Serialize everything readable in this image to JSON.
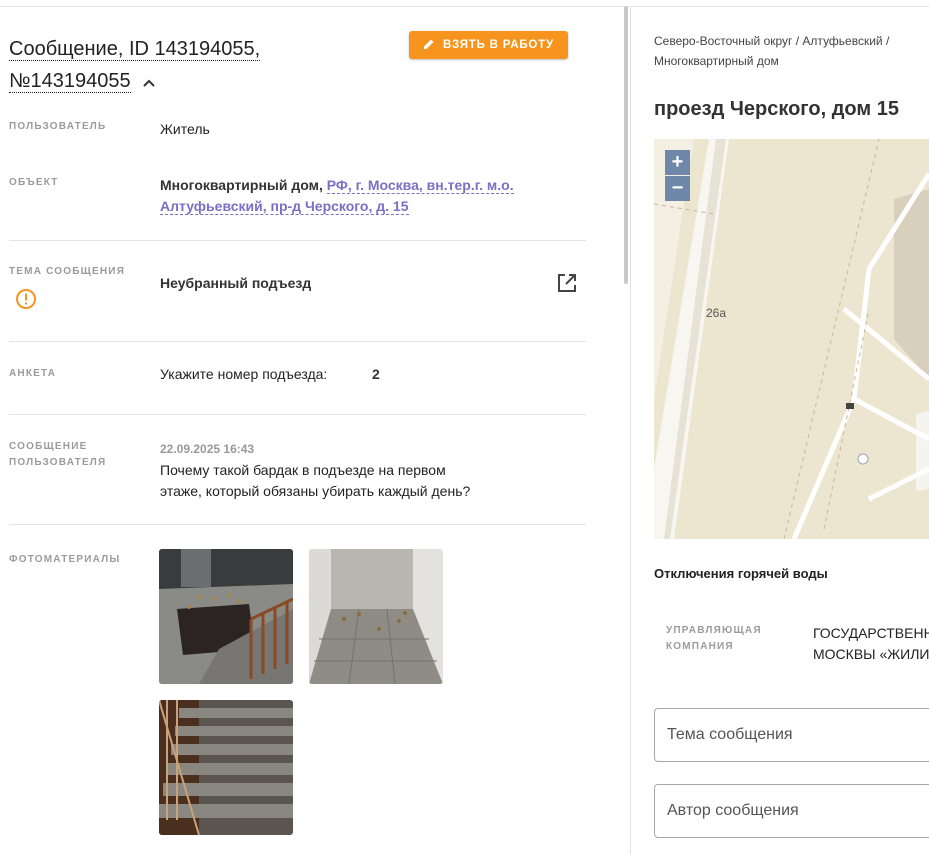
{
  "message": {
    "title_line1": "Сообщение, ID 143194055,",
    "title_line2": "№143194055",
    "take_button": "ВЗЯТЬ В РАБОТУ"
  },
  "fields": {
    "user_label": "ПОЛЬЗОВАТЕЛЬ",
    "user_value": "Житель",
    "object_label": "ОБЪЕКТ",
    "object_type": "Многоквартирный дом,",
    "object_address_line1": "РФ, г. Москва, вн.тер.г. м.о.",
    "object_address_line2": "Алтуфьевский, пр-д Черского, д. 15",
    "topic_label": "ТЕМА СООБЩЕНИЯ",
    "topic_value": "Неубранный подъезд",
    "survey_label": "АНКЕТА",
    "survey_question": "Укажите номер подъезда:",
    "survey_answer": "2",
    "user_message_label_line1": "СООБЩЕНИЕ",
    "user_message_label_line2": "ПОЛЬЗОВАТЕЛЯ",
    "message_timestamp": "22.09.2025 16:43",
    "message_text_line1": "Почему такой бардак в подъезде на первом",
    "message_text_line2": "этаже, который обязаны убирать каждый день?",
    "photos_label": "ФОТОМАТЕРИАЛЫ"
  },
  "location": {
    "breadcrumb_line1": "Северо-Восточный округ / Алтуфьевский /",
    "breadcrumb_line2": "Многоквартирный дом",
    "address": "проезд Черского, дом 15",
    "map_label_26a": "26а",
    "zoom_in": "+",
    "zoom_out": "−",
    "hot_water": "Отключения горячей воды",
    "mc_label_line1": "УПРАВЛЯЮЩАЯ",
    "mc_label_line2": "КОМПАНИЯ",
    "mc_value_line1": "ГОСУДАРСТВЕННО",
    "mc_value_line2": "МОСКВЫ «ЖИЛИЩ"
  },
  "form": {
    "subject_placeholder": "Тема сообщения",
    "author_placeholder": "Автор сообщения"
  },
  "colors": {
    "accent_orange": "#f7941d",
    "link_purple": "#7b6fc4",
    "warning_orange": "#f7941d",
    "map_zoom": "#6f87a8"
  },
  "icons": [
    "pencil-icon",
    "chevron-up-icon",
    "warning-circle-icon",
    "external-link-icon"
  ]
}
